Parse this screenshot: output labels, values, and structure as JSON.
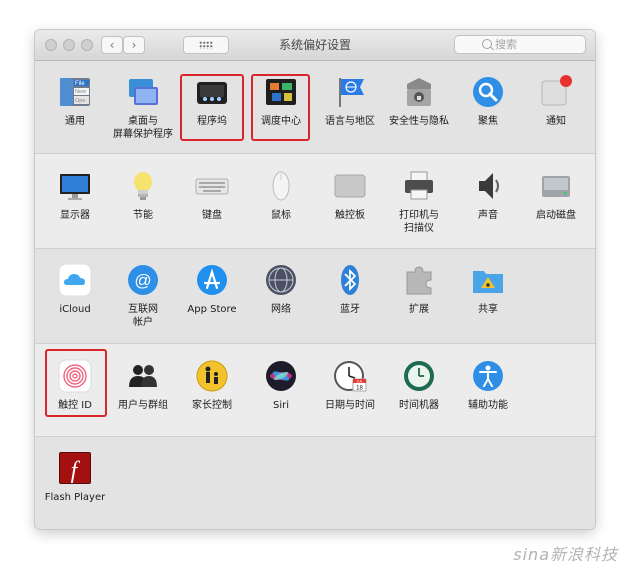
{
  "window": {
    "title": "系统偏好设置",
    "search_placeholder": "搜索"
  },
  "toolbar": {
    "back": "‹",
    "forward": "›"
  },
  "rows": [
    [
      {
        "name": "general",
        "label": "通用"
      },
      {
        "name": "desktop-screensaver",
        "label": "桌面与\n屏幕保护程序"
      },
      {
        "name": "dock",
        "label": "程序坞"
      },
      {
        "name": "mission-control",
        "label": "调度中心"
      },
      {
        "name": "language-region",
        "label": "语言与地区"
      },
      {
        "name": "security-privacy",
        "label": "安全性与隐私"
      },
      {
        "name": "spotlight",
        "label": "聚焦"
      },
      {
        "name": "notifications",
        "label": "通知"
      }
    ],
    [
      {
        "name": "displays",
        "label": "显示器"
      },
      {
        "name": "energy-saver",
        "label": "节能"
      },
      {
        "name": "keyboard",
        "label": "键盘"
      },
      {
        "name": "mouse",
        "label": "鼠标"
      },
      {
        "name": "trackpad",
        "label": "触控板"
      },
      {
        "name": "printers-scanners",
        "label": "打印机与\n扫描仪"
      },
      {
        "name": "sound",
        "label": "声音"
      },
      {
        "name": "startup-disk",
        "label": "启动磁盘"
      }
    ],
    [
      {
        "name": "icloud",
        "label": "iCloud"
      },
      {
        "name": "internet-accounts",
        "label": "互联网\n帐户"
      },
      {
        "name": "app-store",
        "label": "App Store"
      },
      {
        "name": "network",
        "label": "网络"
      },
      {
        "name": "bluetooth",
        "label": "蓝牙"
      },
      {
        "name": "extensions",
        "label": "扩展"
      },
      {
        "name": "sharing",
        "label": "共享"
      }
    ],
    [
      {
        "name": "touch-id",
        "label": "触控 ID"
      },
      {
        "name": "users-groups",
        "label": "用户与群组"
      },
      {
        "name": "parental-controls",
        "label": "家长控制"
      },
      {
        "name": "siri",
        "label": "Siri"
      },
      {
        "name": "date-time",
        "label": "日期与时间"
      },
      {
        "name": "time-machine",
        "label": "时间机器"
      },
      {
        "name": "accessibility",
        "label": "辅助功能"
      }
    ],
    [
      {
        "name": "flash-player",
        "label": "Flash Player"
      }
    ]
  ],
  "icon_text": {
    "general_file": "File",
    "general_new": "New",
    "general_open": "Ope",
    "calendar_month": "JUL",
    "calendar_day": "18",
    "flash_glyph": "f"
  },
  "watermark": "sina新浪科技",
  "highlight_color": "#d8262c"
}
